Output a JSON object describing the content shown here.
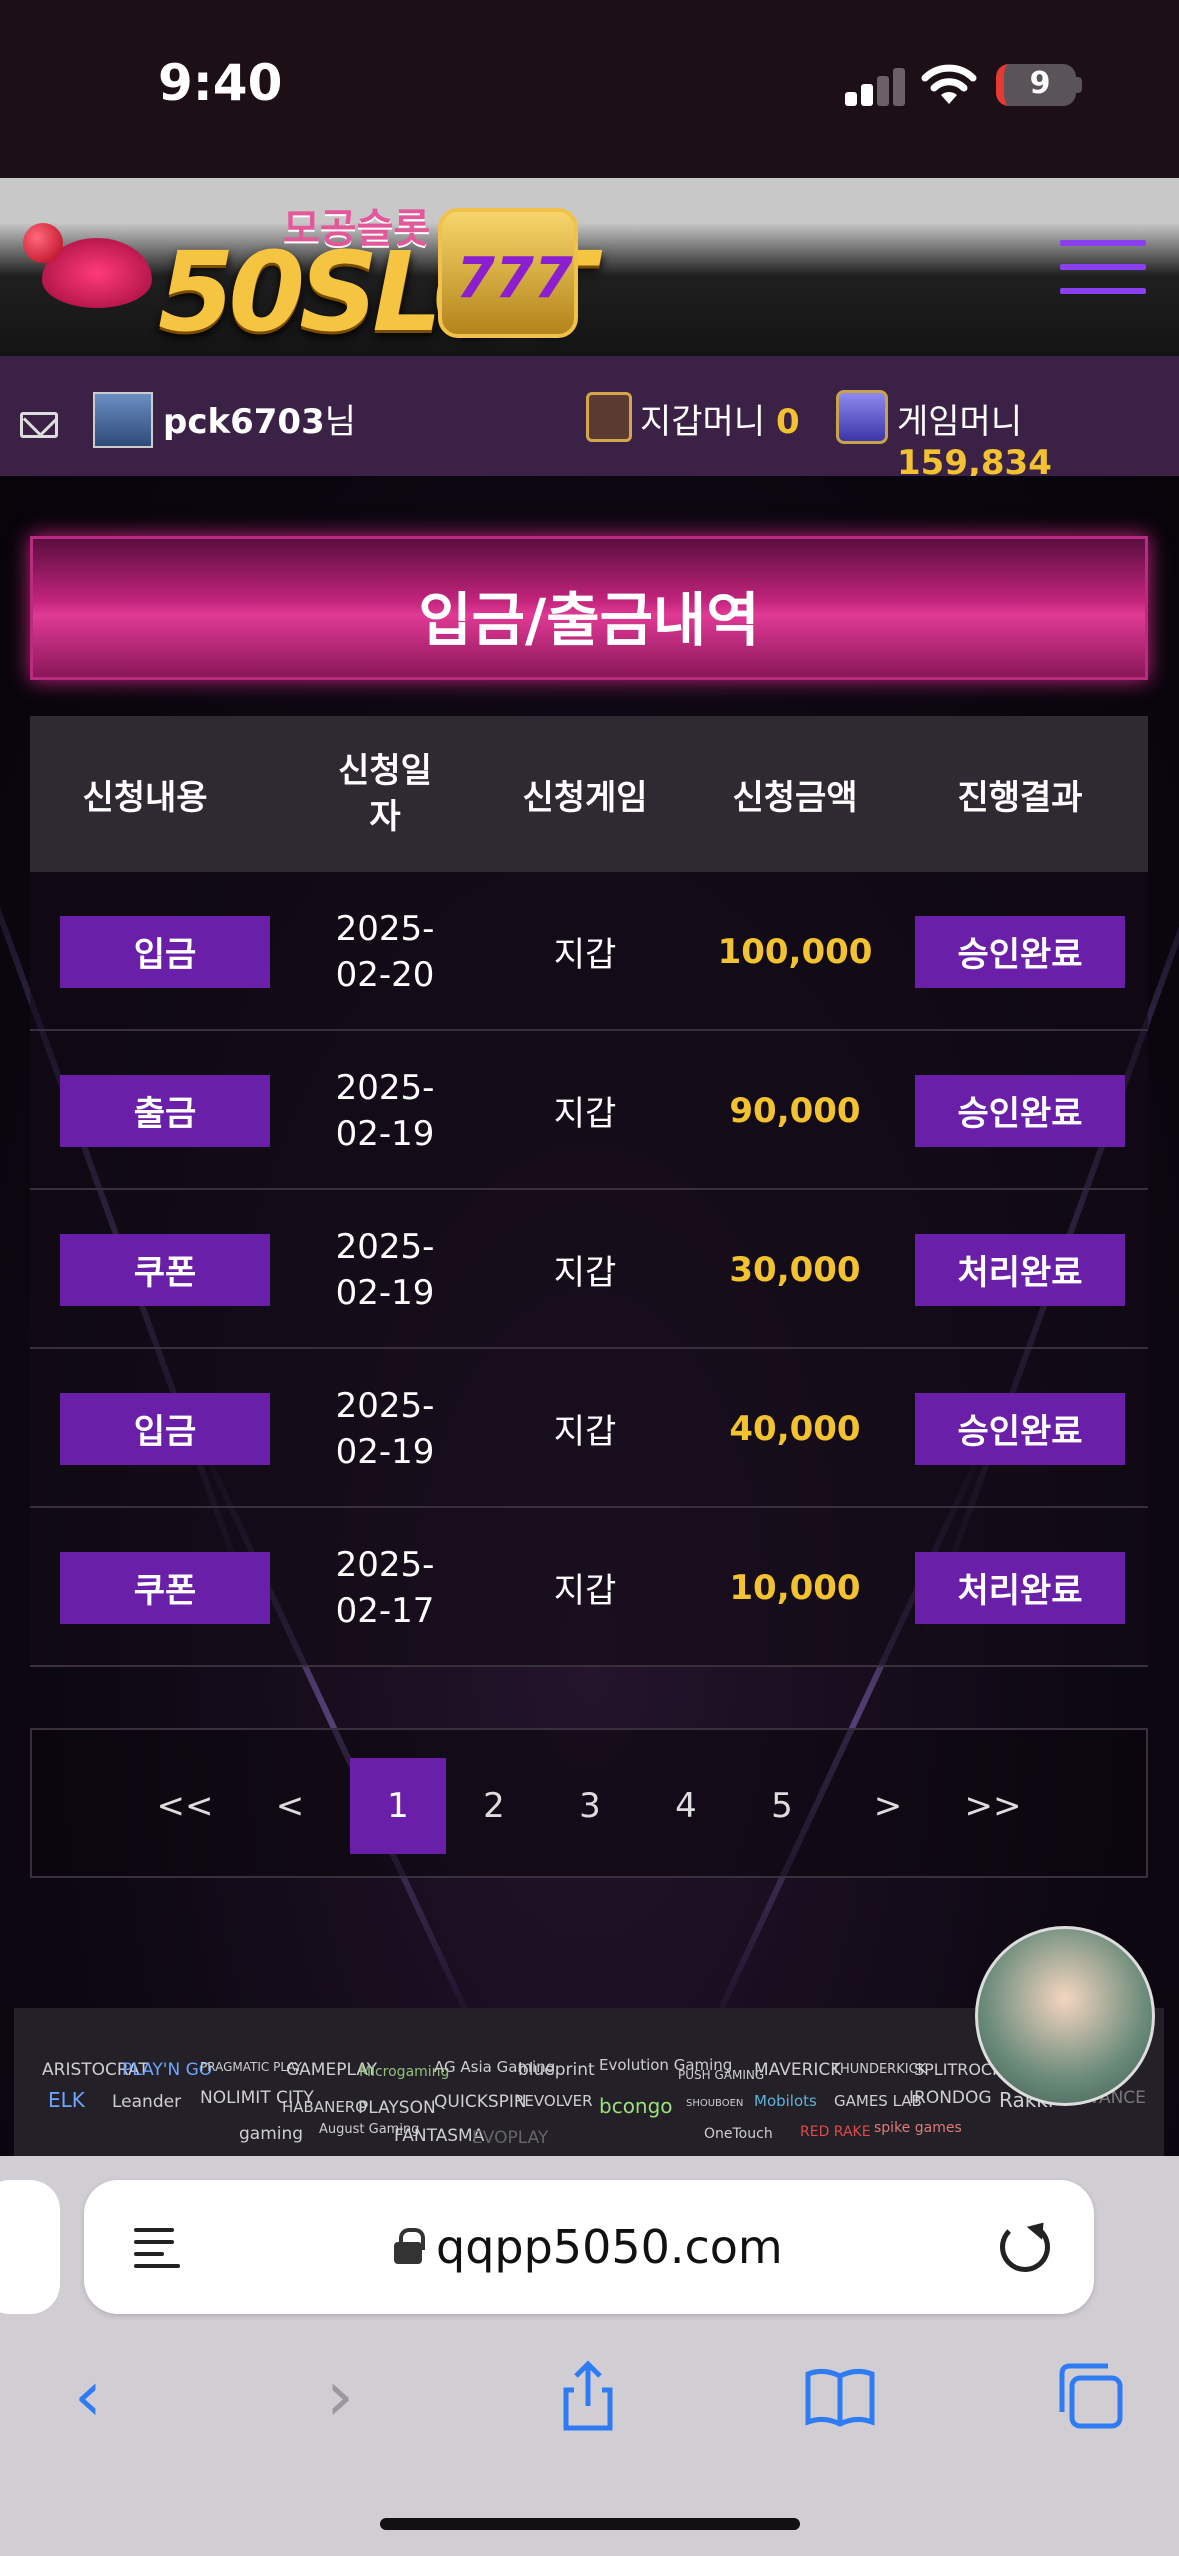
{
  "status_bar": {
    "time": "9:40",
    "battery": "9"
  },
  "header": {
    "logo_main": "50SLOT",
    "logo_sub": "모공슬롯",
    "logo_badge": "777"
  },
  "user_bar": {
    "username": "pck6703",
    "username_suffix": "님",
    "wallet_label": "지갑머니",
    "wallet_value": "0",
    "game_label": "게임머니",
    "game_value": "159,834"
  },
  "page_title": "입금/출금내역",
  "table": {
    "headers": [
      "신청내용",
      "신청일\n자",
      "신청게임",
      "신청금액",
      "진행결과"
    ],
    "rows": [
      {
        "type": "입금",
        "date_line1": "2025-",
        "date_line2": "02-20",
        "game": "지갑",
        "amount": "100,000",
        "status": "승인완료"
      },
      {
        "type": "출금",
        "date_line1": "2025-",
        "date_line2": "02-19",
        "game": "지갑",
        "amount": "90,000",
        "status": "승인완료"
      },
      {
        "type": "쿠폰",
        "date_line1": "2025-",
        "date_line2": "02-19",
        "game": "지갑",
        "amount": "30,000",
        "status": "처리완료"
      },
      {
        "type": "입금",
        "date_line1": "2025-",
        "date_line2": "02-19",
        "game": "지갑",
        "amount": "40,000",
        "status": "승인완료"
      },
      {
        "type": "쿠폰",
        "date_line1": "2025-",
        "date_line2": "02-17",
        "game": "지갑",
        "amount": "10,000",
        "status": "처리완료"
      }
    ]
  },
  "pagination": {
    "first": "<<",
    "prev": "<",
    "pages": [
      "1",
      "2",
      "3",
      "4",
      "5"
    ],
    "next": ">",
    "last": ">>",
    "current": "1"
  },
  "providers": {
    "row1": [
      "ARISTOCRAT",
      "PLAY'N GO",
      "PRAGMATIC PLAY",
      "GAMEPLAY",
      "Microgaming",
      "AG Asia Gaming",
      "blueprint",
      "Evolution Gaming",
      "PUSH GAMING",
      "MAVERICK",
      "THUNDERKICK",
      "SPLITROCK"
    ],
    "row2": [
      "ELK",
      "Leander",
      "NOLIMIT CITY",
      "HABANERO",
      "PLAYSON",
      "QUICKSPIN",
      "REVOLVER",
      "bcongo",
      "SHOUBOEN",
      "Mobilots",
      "GAMES LAB",
      "IRONDOG",
      "Rakki",
      "ADVANCE"
    ],
    "row3": [
      "gaming",
      "August Gaming",
      "FANTASMA",
      "EVOPLAY",
      "",
      "",
      "OneTouch",
      "RED RAKE",
      "spike games"
    ]
  },
  "browser": {
    "url": "qqpp5050.com"
  }
}
